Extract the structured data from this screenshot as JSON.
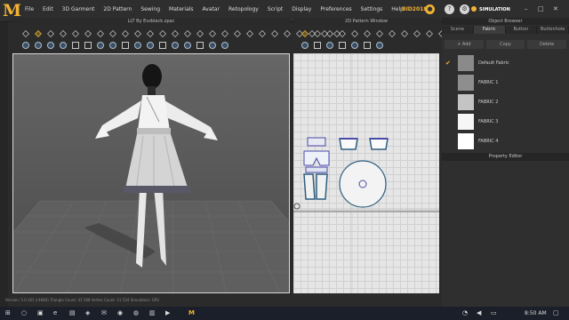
{
  "menubar": {
    "items": [
      "File",
      "Edit",
      "3D Garment",
      "2D Pattern",
      "Sewing",
      "Materials",
      "Avatar",
      "Retopology",
      "Script",
      "Display",
      "Preferences",
      "Settings",
      "Help"
    ],
    "build": "BID2018",
    "mode": "SIMULATION"
  },
  "view3d": {
    "title": "LLT By Evzblack.zpac"
  },
  "view2d": {
    "title": "2D Pattern Window"
  },
  "object_browser": {
    "title": "Object Browser",
    "tabs": [
      "Scene",
      "Fabric",
      "Button",
      "Buttonhole"
    ],
    "active_tab": "Fabric",
    "add_label": "+ Add",
    "copy_label": "Copy",
    "delete_label": "Delete",
    "fabrics": [
      {
        "name": "Default Fabric",
        "color": "#8a8a8a",
        "checked": true
      },
      {
        "name": "FABRIC 1",
        "color": "#8e8e8e",
        "checked": false
      },
      {
        "name": "FABRIC 2",
        "color": "#c4c4c4",
        "checked": false
      },
      {
        "name": "FABRIC 3",
        "color": "#f6f6f6",
        "checked": false
      },
      {
        "name": "FABRIC 4",
        "color": "#ffffff",
        "checked": false
      }
    ]
  },
  "property_editor": {
    "title": "Property Editor"
  },
  "status": {
    "text": "Version: 5.0.161 (r4680)  Triangle Count: 41 568  Vertex Count: 21 524  Simulation: GPU"
  },
  "taskbar": {
    "time": "8:50 AM"
  },
  "icons": [
    "windows-start-icon",
    "search-icon",
    "task-view-icon",
    "edge-icon",
    "file-explorer-icon",
    "marvelous-designer-icon"
  ]
}
